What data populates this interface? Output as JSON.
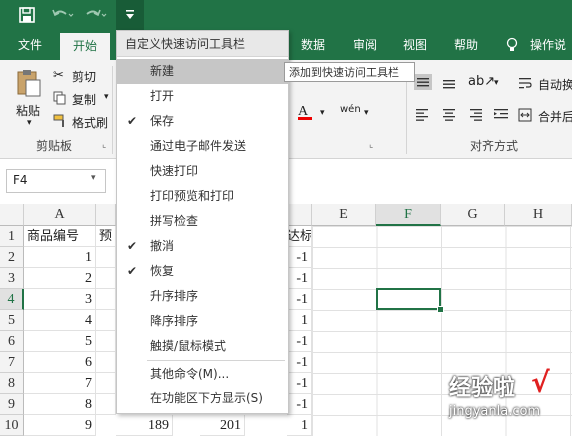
{
  "quick_access": {
    "save_icon": "save-icon",
    "undo_icon": "undo-icon",
    "redo_icon": "redo-icon",
    "customize_icon": "customize-qat-icon"
  },
  "tabs": [
    {
      "label": "文件"
    },
    {
      "label": "开始"
    },
    {
      "label": "数据"
    },
    {
      "label": "审阅"
    },
    {
      "label": "视图"
    },
    {
      "label": "帮助"
    },
    {
      "label": "操作说"
    }
  ],
  "ribbon": {
    "paste_label": "粘贴",
    "cut_label": "剪切",
    "copy_label": "复制",
    "format_painter_label": "格式刷",
    "clipboard_group": "剪贴板",
    "alignment_group": "对齐方式",
    "wrap_label": "自动换",
    "merge_label": "合并后"
  },
  "name_box": {
    "value": "F4"
  },
  "menu": {
    "title": "自定义快速访问工具栏",
    "items": [
      {
        "label": "新建",
        "checked": false
      },
      {
        "label": "打开",
        "checked": false
      },
      {
        "label": "保存",
        "checked": true
      },
      {
        "label": "通过电子邮件发送",
        "checked": false
      },
      {
        "label": "快速打印",
        "checked": false
      },
      {
        "label": "打印预览和打印",
        "checked": false
      },
      {
        "label": "拼写检查",
        "checked": false
      },
      {
        "label": "撤消",
        "checked": true
      },
      {
        "label": "恢复",
        "checked": true
      },
      {
        "label": "升序排序",
        "checked": false
      },
      {
        "label": "降序排序",
        "checked": false
      },
      {
        "label": "触摸/鼠标模式",
        "checked": false
      },
      {
        "label": "其他命令(M)...",
        "checked": false
      },
      {
        "label": "在功能区下方显示(S)",
        "checked": false
      }
    ],
    "check_mark": "✔"
  },
  "tooltip": "添加到快速访问工具栏",
  "grid": {
    "columns": [
      "A",
      "E",
      "F",
      "G",
      "H"
    ],
    "rows": [
      "1",
      "2",
      "3",
      "4",
      "5",
      "6",
      "7",
      "8",
      "9",
      "10"
    ],
    "a_col": [
      "商品编号",
      "1",
      "2",
      "3",
      "4",
      "5",
      "6",
      "7",
      "8",
      "9"
    ],
    "b_header": "预",
    "b_last": "189",
    "c_last": "201",
    "d_header": "达标",
    "d_col": [
      "-1",
      "-1",
      "-1",
      "1",
      "-1",
      "-1",
      "-1",
      "-1",
      "1"
    ]
  },
  "watermark": {
    "text": "经验啦",
    "check": "√",
    "url": "jingyanla.com"
  },
  "colors": {
    "accent": "#217346",
    "menu_highlight": "#c6c6c6"
  }
}
